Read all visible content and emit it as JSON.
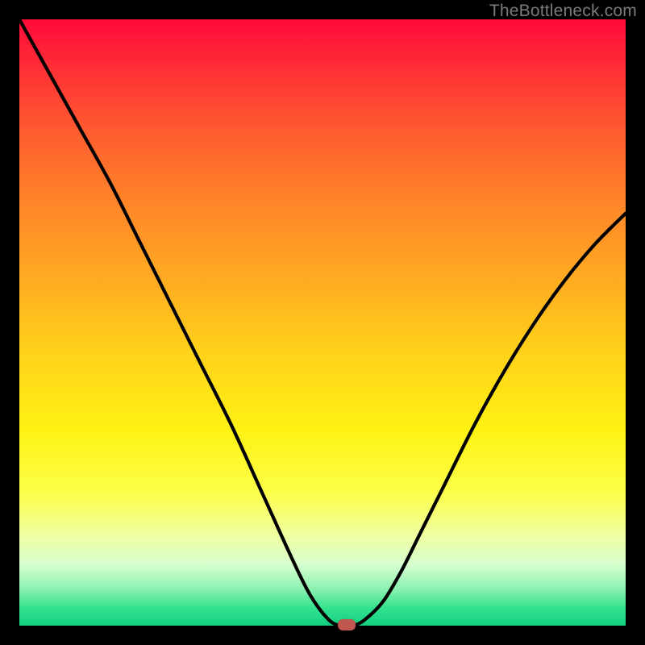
{
  "watermark": "TheBottleneck.com",
  "chart_data": {
    "type": "line",
    "title": "",
    "xlabel": "",
    "ylabel": "",
    "xlim": [
      0,
      100
    ],
    "ylim": [
      0,
      100
    ],
    "grid": false,
    "legend": false,
    "background_gradient": {
      "direction": "vertical",
      "stops": [
        {
          "pos": 0.0,
          "color": "#ff0a3a"
        },
        {
          "pos": 0.3,
          "color": "#ff8428"
        },
        {
          "pos": 0.55,
          "color": "#ffd21a"
        },
        {
          "pos": 0.78,
          "color": "#fcff4a"
        },
        {
          "pos": 0.9,
          "color": "#d6ffd0"
        },
        {
          "pos": 1.0,
          "color": "#12d080"
        }
      ]
    },
    "series": [
      {
        "name": "bottleneck-curve",
        "x": [
          0,
          5,
          10,
          15,
          20,
          25,
          30,
          35,
          40,
          45,
          48,
          51,
          53,
          55,
          57,
          60,
          63,
          66,
          70,
          75,
          80,
          85,
          90,
          95,
          100
        ],
        "y": [
          100,
          91,
          82,
          73,
          63,
          53,
          43,
          33,
          22,
          11,
          5,
          1,
          0,
          0,
          1,
          4,
          9,
          15,
          23,
          33,
          42,
          50,
          57,
          63,
          68
        ]
      }
    ],
    "marker": {
      "x": 54,
      "y": 0,
      "color": "#c0574e",
      "shape": "rounded-rect"
    }
  }
}
